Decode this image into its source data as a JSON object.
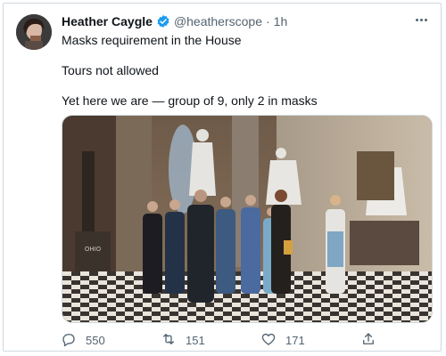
{
  "tweet": {
    "author_name": "Heather Caygle",
    "handle": "@heatherscope",
    "separator": "·",
    "time": "1h",
    "lines": [
      "Masks requirement in the House",
      "Tours not allowed",
      "Yet here we are — group of 9, only 2 in masks"
    ],
    "media_inscription": "OHIO"
  },
  "actions": {
    "reply_count": "550",
    "retweet_count": "151",
    "like_count": "171"
  },
  "icons": {
    "verified": "verified-badge-icon",
    "reply": "speech-bubble-icon",
    "retweet": "retweet-arrows-icon",
    "like": "heart-icon",
    "share": "upload-arrow-icon",
    "more": "ellipsis-icon"
  },
  "colors": {
    "verified_blue": "#1d9bf0",
    "muted_text": "#536471",
    "border": "#cfd9de"
  }
}
